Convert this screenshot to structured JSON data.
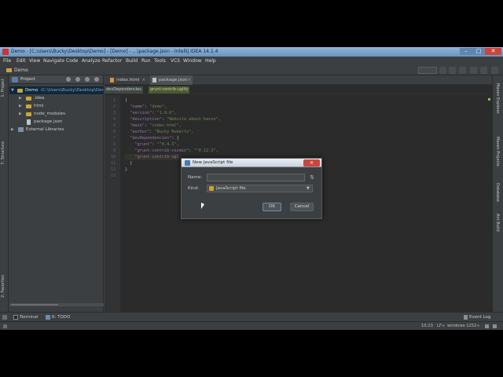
{
  "window": {
    "title": "Demo - [C:\\Users\\Bucky\\Desktop\\Demo] - [Demo] - ...\\package.json - IntelliJ IDEA 14.1.4",
    "controls": {
      "minimize": "–",
      "maximize": "□",
      "close": "✕"
    }
  },
  "menu": [
    "File",
    "Edit",
    "View",
    "Navigate",
    "Code",
    "Analyze",
    "Refactor",
    "Build",
    "Run",
    "Tools",
    "VCS",
    "Window",
    "Help"
  ],
  "navbar": {
    "crumb": "Demo"
  },
  "left_strip": {
    "project": "1: Project",
    "structure": "7: Structure",
    "favorites": "2: Favorites"
  },
  "right_strip": {
    "maven_explorer": "Maven Explorer",
    "maven_projects": "Maven Projects",
    "database": "Database",
    "ant_build": "Ant Build"
  },
  "project_panel": {
    "title": "Project",
    "tree": [
      {
        "label": "Demo",
        "path": "(C:\\Users\\Bucky\\Desktop\\Dem",
        "arrow": "▼"
      },
      {
        "label": ".idea",
        "arrow": "▶"
      },
      {
        "label": "html",
        "arrow": "▶"
      },
      {
        "label": "node_modules",
        "arrow": "▶"
      },
      {
        "label": "package.json"
      },
      {
        "label": "External Libraries",
        "arrow": "▶"
      }
    ]
  },
  "editor": {
    "tabs": [
      {
        "label": "index.html",
        "close": "×"
      },
      {
        "label": "package.json",
        "close": "×"
      }
    ],
    "crumbs": [
      "devDependencies",
      "grunt-contrib-uglify"
    ],
    "line_numbers": [
      "1",
      "2",
      "3",
      "4",
      "5",
      "6",
      "7",
      "8",
      "9",
      "10",
      "11",
      "12",
      "13"
    ],
    "lines": [
      {
        "ind": "",
        "key": "",
        "sep": "",
        "val": "{",
        "end": ""
      },
      {
        "ind": "  ",
        "key": "\"name\"",
        "sep": ": ",
        "val": "\"demo\"",
        "end": ","
      },
      {
        "ind": "  ",
        "key": "\"version\"",
        "sep": ": ",
        "val": "\"1.0.0\"",
        "end": ","
      },
      {
        "ind": "  ",
        "key": "\"description\"",
        "sep": ": ",
        "val": "\"Website about bacon\"",
        "end": ","
      },
      {
        "ind": "  ",
        "key": "\"main\"",
        "sep": ": ",
        "val": "\"index.html\"",
        "end": ","
      },
      {
        "ind": "  ",
        "key": "\"author\"",
        "sep": ": ",
        "val": "\"Bucky Roberts\"",
        "end": ","
      },
      {
        "ind": "  ",
        "key": "\"devDependencies\"",
        "sep": ": ",
        "val": "{",
        "end": ""
      },
      {
        "ind": "    ",
        "key": "\"grunt\"",
        "sep": ": ",
        "val": "\"^0.4.5\"",
        "end": ","
      },
      {
        "ind": "    ",
        "key": "\"grunt-contrib-cssmin\"",
        "sep": ": ",
        "val": "\"^0.12.3\"",
        "end": ","
      },
      {
        "ind": "    ",
        "key": "\"grunt-contrib-ugl",
        "sep": "",
        "val": "",
        "end": ""
      },
      {
        "ind": "  ",
        "key": "",
        "sep": "",
        "val": "}",
        "end": ""
      },
      {
        "ind": "",
        "key": "",
        "sep": "",
        "val": "}",
        "end": ""
      },
      {
        "ind": "",
        "key": "",
        "sep": "",
        "val": "",
        "end": ""
      }
    ]
  },
  "dialog": {
    "title": "New JavaScript file",
    "close": "✕",
    "name_label": "Name:",
    "name_value": "",
    "sort_glyph": "⇅",
    "kind_label": "Kind:",
    "kind_value": "JavaScript file",
    "kind_arrow": "▼",
    "ok_label": "OK",
    "cancel_label": "Cancel"
  },
  "bottom_tabs": {
    "terminal": "Terminal",
    "todo": "6: TODO",
    "event_log": "Event Log"
  },
  "status": {
    "position": "10:23",
    "line_sep": "LF÷",
    "encoding": "windows-1252÷"
  },
  "colors": {
    "accent": "#6a8fb5",
    "keyword": "#9876aa",
    "string": "#6a8759",
    "background": "#2b2b2b"
  }
}
